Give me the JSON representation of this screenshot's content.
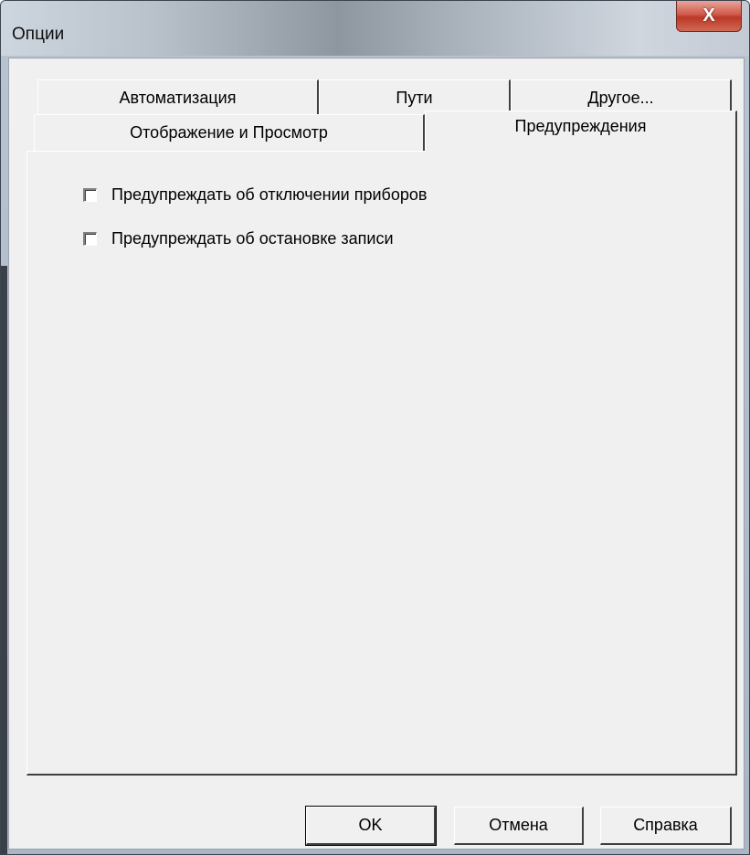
{
  "window": {
    "title": "Опции",
    "close_glyph": "X"
  },
  "tabs": {
    "row_back": [
      {
        "label": "Автоматизация"
      },
      {
        "label": "Пути"
      },
      {
        "label": "Другое..."
      }
    ],
    "row_front": [
      {
        "label": "Отображение и Просмотр"
      },
      {
        "label": "Предупреждения",
        "selected": true
      }
    ]
  },
  "warnings": {
    "options": [
      {
        "label": "Предупреждать об отключении приборов",
        "checked": false
      },
      {
        "label": "Предупреждать об остановке записи",
        "checked": false
      }
    ]
  },
  "buttons": {
    "ok": "OK",
    "cancel": "Отмена",
    "help": "Справка"
  }
}
